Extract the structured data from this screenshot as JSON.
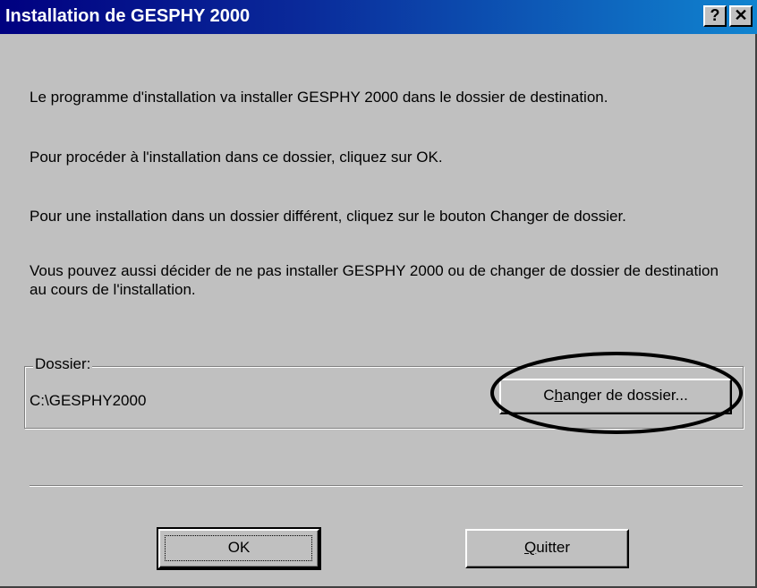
{
  "window": {
    "title": "Installation de GESPHY 2000",
    "help_glyph": "?",
    "close_glyph": "✕"
  },
  "messages": [
    "Le programme d'installation va installer GESPHY 2000 dans le dossier de destination.",
    "Pour procéder à l'installation dans ce dossier, cliquez sur OK.",
    "Pour une installation dans un dossier différent, cliquez sur le bouton Changer de dossier.",
    "Vous pouvez aussi décider de ne pas installer GESPHY 2000 ou de changer de dossier de destination au cours de l'installation."
  ],
  "folder": {
    "label": "Dossier:",
    "path": "C:\\GESPHY2000",
    "change_button": {
      "prefix": "C",
      "mnemonic": "h",
      "rest": "anger de dossier..."
    }
  },
  "buttons": {
    "ok": "OK",
    "quit": {
      "mnemonic": "Q",
      "rest": "uitter"
    }
  },
  "colors": {
    "dialog_bg": "#c0c0c0",
    "titlebar_start": "#000080",
    "titlebar_end": "#1084d0",
    "annotation": "#000000"
  },
  "icons": [
    "help-icon",
    "close-icon"
  ]
}
